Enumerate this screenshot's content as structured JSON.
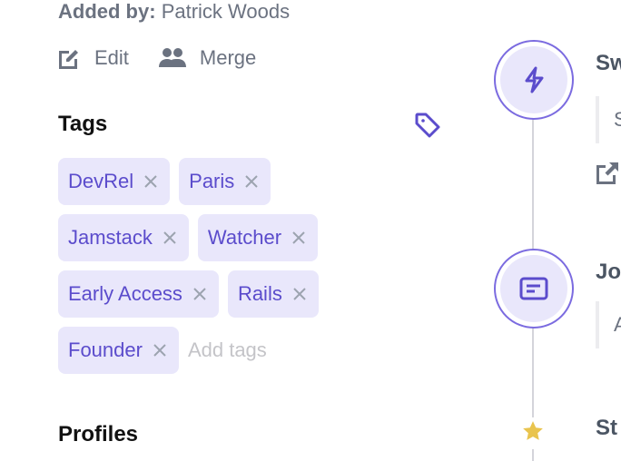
{
  "added_by": {
    "label": "Added by:",
    "name": "Patrick Woods"
  },
  "actions": [
    {
      "label": "Edit",
      "icon": "edit-icon"
    },
    {
      "label": "Merge",
      "icon": "users-icon"
    }
  ],
  "tags": {
    "title": "Tags",
    "icon": "tag-icon",
    "items": [
      "DevRel",
      "Paris",
      "Jamstack",
      "Watcher",
      "Early Access",
      "Rails",
      "Founder"
    ],
    "placeholder": "Add tags"
  },
  "profiles": {
    "title": "Profiles"
  },
  "timeline": {
    "items": [
      {
        "icon": "lightning-icon",
        "title": "Sw",
        "quote": "S",
        "has_link": true
      },
      {
        "icon": "message-icon",
        "title": "Jo",
        "quote": "A"
      },
      {
        "icon": "star-icon",
        "title": "St"
      }
    ]
  },
  "colors": {
    "accent": "#5b4ccc",
    "tag_bg": "#e9e7fb",
    "star": "#e9c44e",
    "muted": "#6b7280"
  }
}
